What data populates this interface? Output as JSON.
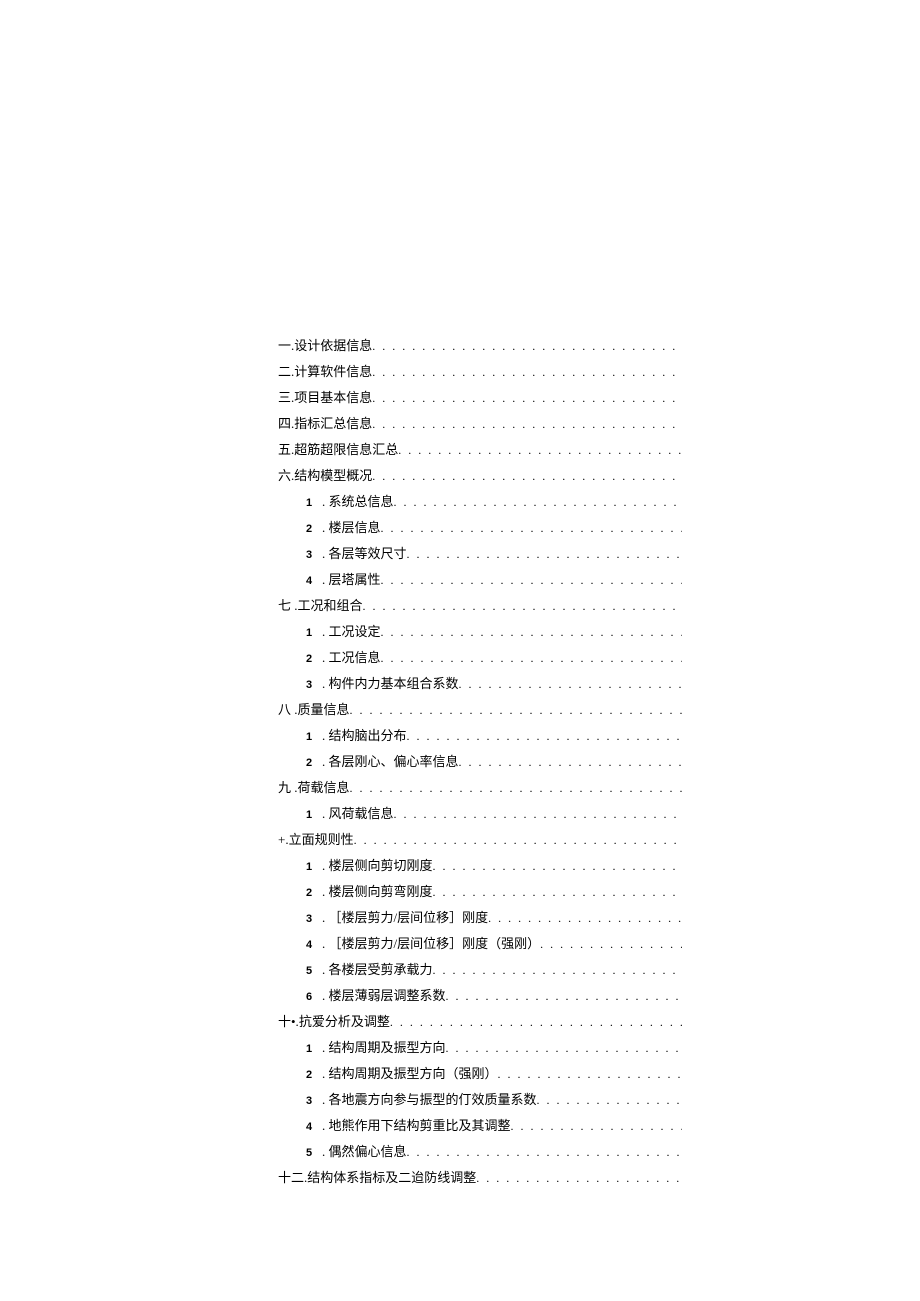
{
  "toc": [
    {
      "level": 0,
      "label": "一.",
      "text": "设计依据信息"
    },
    {
      "level": 0,
      "label": "二.",
      "text": "计算软件信息"
    },
    {
      "level": 0,
      "label": "三.",
      "text": "项目基本信息"
    },
    {
      "level": 0,
      "label": "四.",
      "text": "指标汇总信息"
    },
    {
      "level": 0,
      "label": "五.",
      "text": "超筋超限信息汇总"
    },
    {
      "level": 0,
      "label": "六.",
      "text": "结构模型概况"
    },
    {
      "level": 1,
      "label": "1",
      "text": ". 系统总信息"
    },
    {
      "level": 1,
      "label": "2",
      "text": ". 楼层信息 "
    },
    {
      "level": 1,
      "label": "3",
      "text": ". 各层等效尺寸 "
    },
    {
      "level": 1,
      "label": "4",
      "text": ". 层塔属性"
    },
    {
      "level": 0,
      "label": "七    . ",
      "text": "工况和组合"
    },
    {
      "level": 1,
      "label": "1",
      "text": ". 工况设定"
    },
    {
      "level": 1,
      "label": "2",
      "text": ". 工况信息 "
    },
    {
      "level": 1,
      "label": "3",
      "text": ". 构件内力基本组合系数 "
    },
    {
      "level": 0,
      "label": "八   . ",
      "text": "质量信息"
    },
    {
      "level": 1,
      "label": "1",
      "text": ". 结构脑出分布"
    },
    {
      "level": 1,
      "label": "2",
      "text": ". 各层刚心、偏心率信息 "
    },
    {
      "level": 0,
      "label": "九    . ",
      "text": "荷载信息 "
    },
    {
      "level": 1,
      "label": "1",
      "text": ". 风荷载信息"
    },
    {
      "level": 0,
      "label": "+. ",
      "text": "立面规则性"
    },
    {
      "level": 1,
      "label": "1",
      "text": ". 楼层侧向剪切刚度"
    },
    {
      "level": 1,
      "label": "2",
      "text": ". 楼层侧向剪弯刚度 "
    },
    {
      "level": 1,
      "label": "3",
      "text": ". ［楼层剪力/层间位移］刚度 "
    },
    {
      "level": 1,
      "label": "4",
      "text": ". ［楼层剪力/层间位移］刚度（强刚）  "
    },
    {
      "level": 1,
      "label": "5",
      "text": ". 各楼层受剪承载力 "
    },
    {
      "level": 1,
      "label": "6",
      "text": ". 楼层薄弱层调整系数 "
    },
    {
      "level": 0,
      "label": "十•. ",
      "text": "抗爱分析及调整"
    },
    {
      "level": 1,
      "label": "1",
      "text": ". 结构周期及振型方向"
    },
    {
      "level": 1,
      "label": "2",
      "text": ". 结构周期及振型方向（强刚）  "
    },
    {
      "level": 1,
      "label": "3",
      "text": ". 各地震方向参与振型的仃效质量系数 "
    },
    {
      "level": 1,
      "label": "4",
      "text": ". 地熊作用下结构剪重比及其调整"
    },
    {
      "level": 1,
      "label": "5",
      "text": ". 偶然偏心信息 "
    },
    {
      "level": 0,
      "label": "十二.",
      "text": "结构体系指标及二迨防线调整"
    }
  ]
}
